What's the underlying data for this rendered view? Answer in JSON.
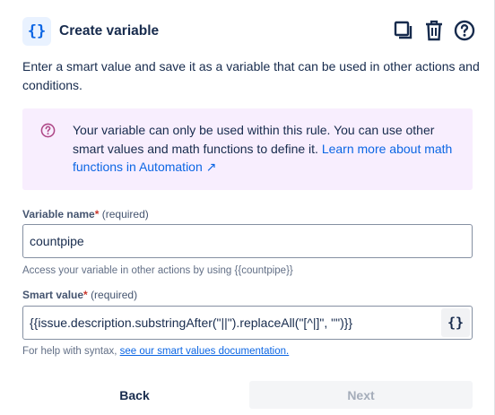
{
  "header": {
    "icon_glyph": "{}",
    "icon_name": "curly-braces-icon",
    "title": "Create variable",
    "actions": [
      {
        "name": "duplicate-icon"
      },
      {
        "name": "trash-icon"
      },
      {
        "name": "help-icon"
      }
    ]
  },
  "description": "Enter a smart value and save it as a variable that can be used in other actions and conditions.",
  "info": {
    "text": "Your variable can only be used within this rule. You can use other smart values and math functions to define it. ",
    "link": "Learn more about math functions in Automation ↗"
  },
  "variable_name": {
    "label": "Variable name",
    "required_mark": "*",
    "required_text": "(required)",
    "value": "countpipe",
    "helper": "Access your variable in other actions by using {{countpipe}}"
  },
  "smart_value": {
    "label": "Smart value",
    "required_mark": "*",
    "required_text": "(required)",
    "value": "{{issue.description.substringAfter(\"||\").replaceAll(\"[^|]\", \"\")}}",
    "button_glyph": "{}",
    "helper_prefix": "For help with syntax, ",
    "helper_link": "see our smart values documentation."
  },
  "footer": {
    "back_label": "Back",
    "next_label": "Next"
  },
  "colors": {
    "accent": "#0c66e4",
    "info_bg": "#f8eefe",
    "info_icon": "#ae4787",
    "required": "#c9372c"
  }
}
